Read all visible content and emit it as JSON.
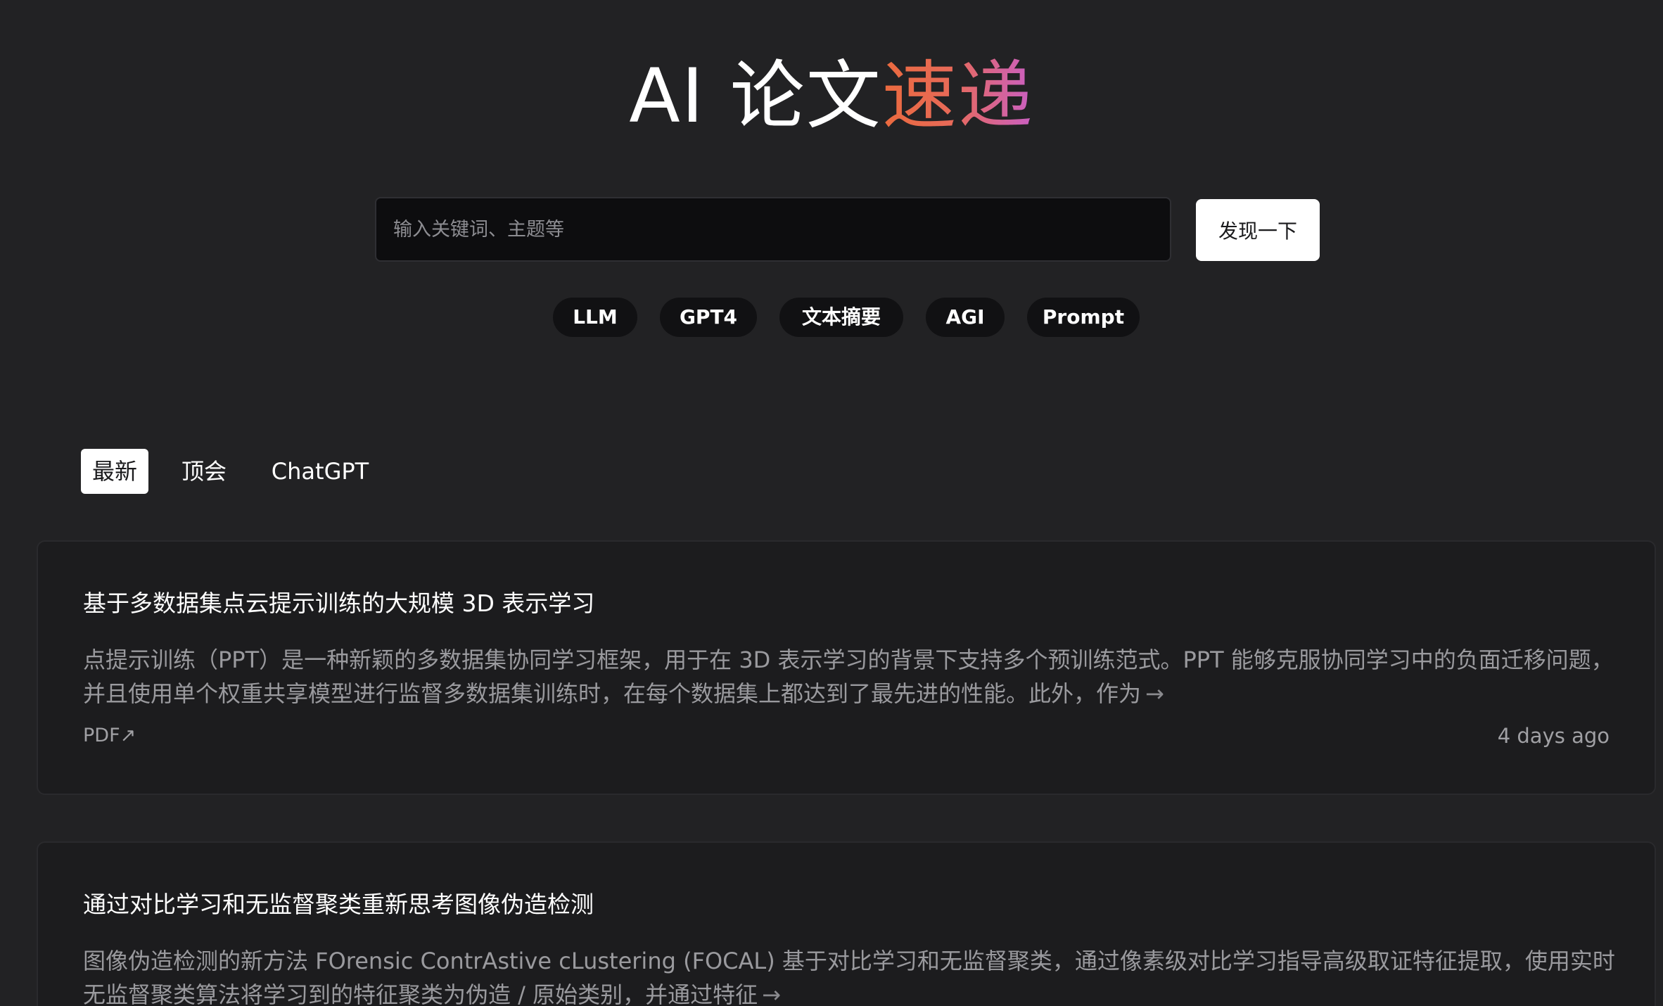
{
  "hero": {
    "title_plain": "AI 论文",
    "title_accent": "速递"
  },
  "search": {
    "placeholder": "输入关键词、主题等",
    "button_label": "发现一下"
  },
  "tags": [
    "LLM",
    "GPT4",
    "文本摘要",
    "AGI",
    "Prompt"
  ],
  "tabs": [
    {
      "label": "最新",
      "active": true
    },
    {
      "label": "顶会",
      "active": false
    },
    {
      "label": "ChatGPT",
      "active": false
    }
  ],
  "papers": [
    {
      "title": "基于多数据集点云提示训练的大规模 3D 表示学习",
      "summary": "点提示训练（PPT）是一种新颖的多数据集协同学习框架，用于在 3D 表示学习的背景下支持多个预训练范式。PPT 能够克服协同学习中的负面迁移问题，并且使用单个权重共享模型进行监督多数据集训练时，在每个数据集上都达到了最先进的性能。此外，作为",
      "arrow": "→",
      "pdf_label": "PDF↗",
      "date": "4 days ago"
    },
    {
      "title": "通过对比学习和无监督聚类重新思考图像伪造检测",
      "summary": "图像伪造检测的新方法 FOrensic ContrAstive cLustering (FOCAL) 基于对比学习和无监督聚类，通过像素级对比学习指导高级取证特征提取，使用实时无监督聚类算法将学习到的特征聚类为伪造 / 原始类别，并通过特征",
      "arrow": "→"
    }
  ],
  "colors": {
    "background": "#222224",
    "accent_start": "#ea6a3e",
    "accent_end": "#c95fc4",
    "card_background": "#1c1c1e"
  }
}
